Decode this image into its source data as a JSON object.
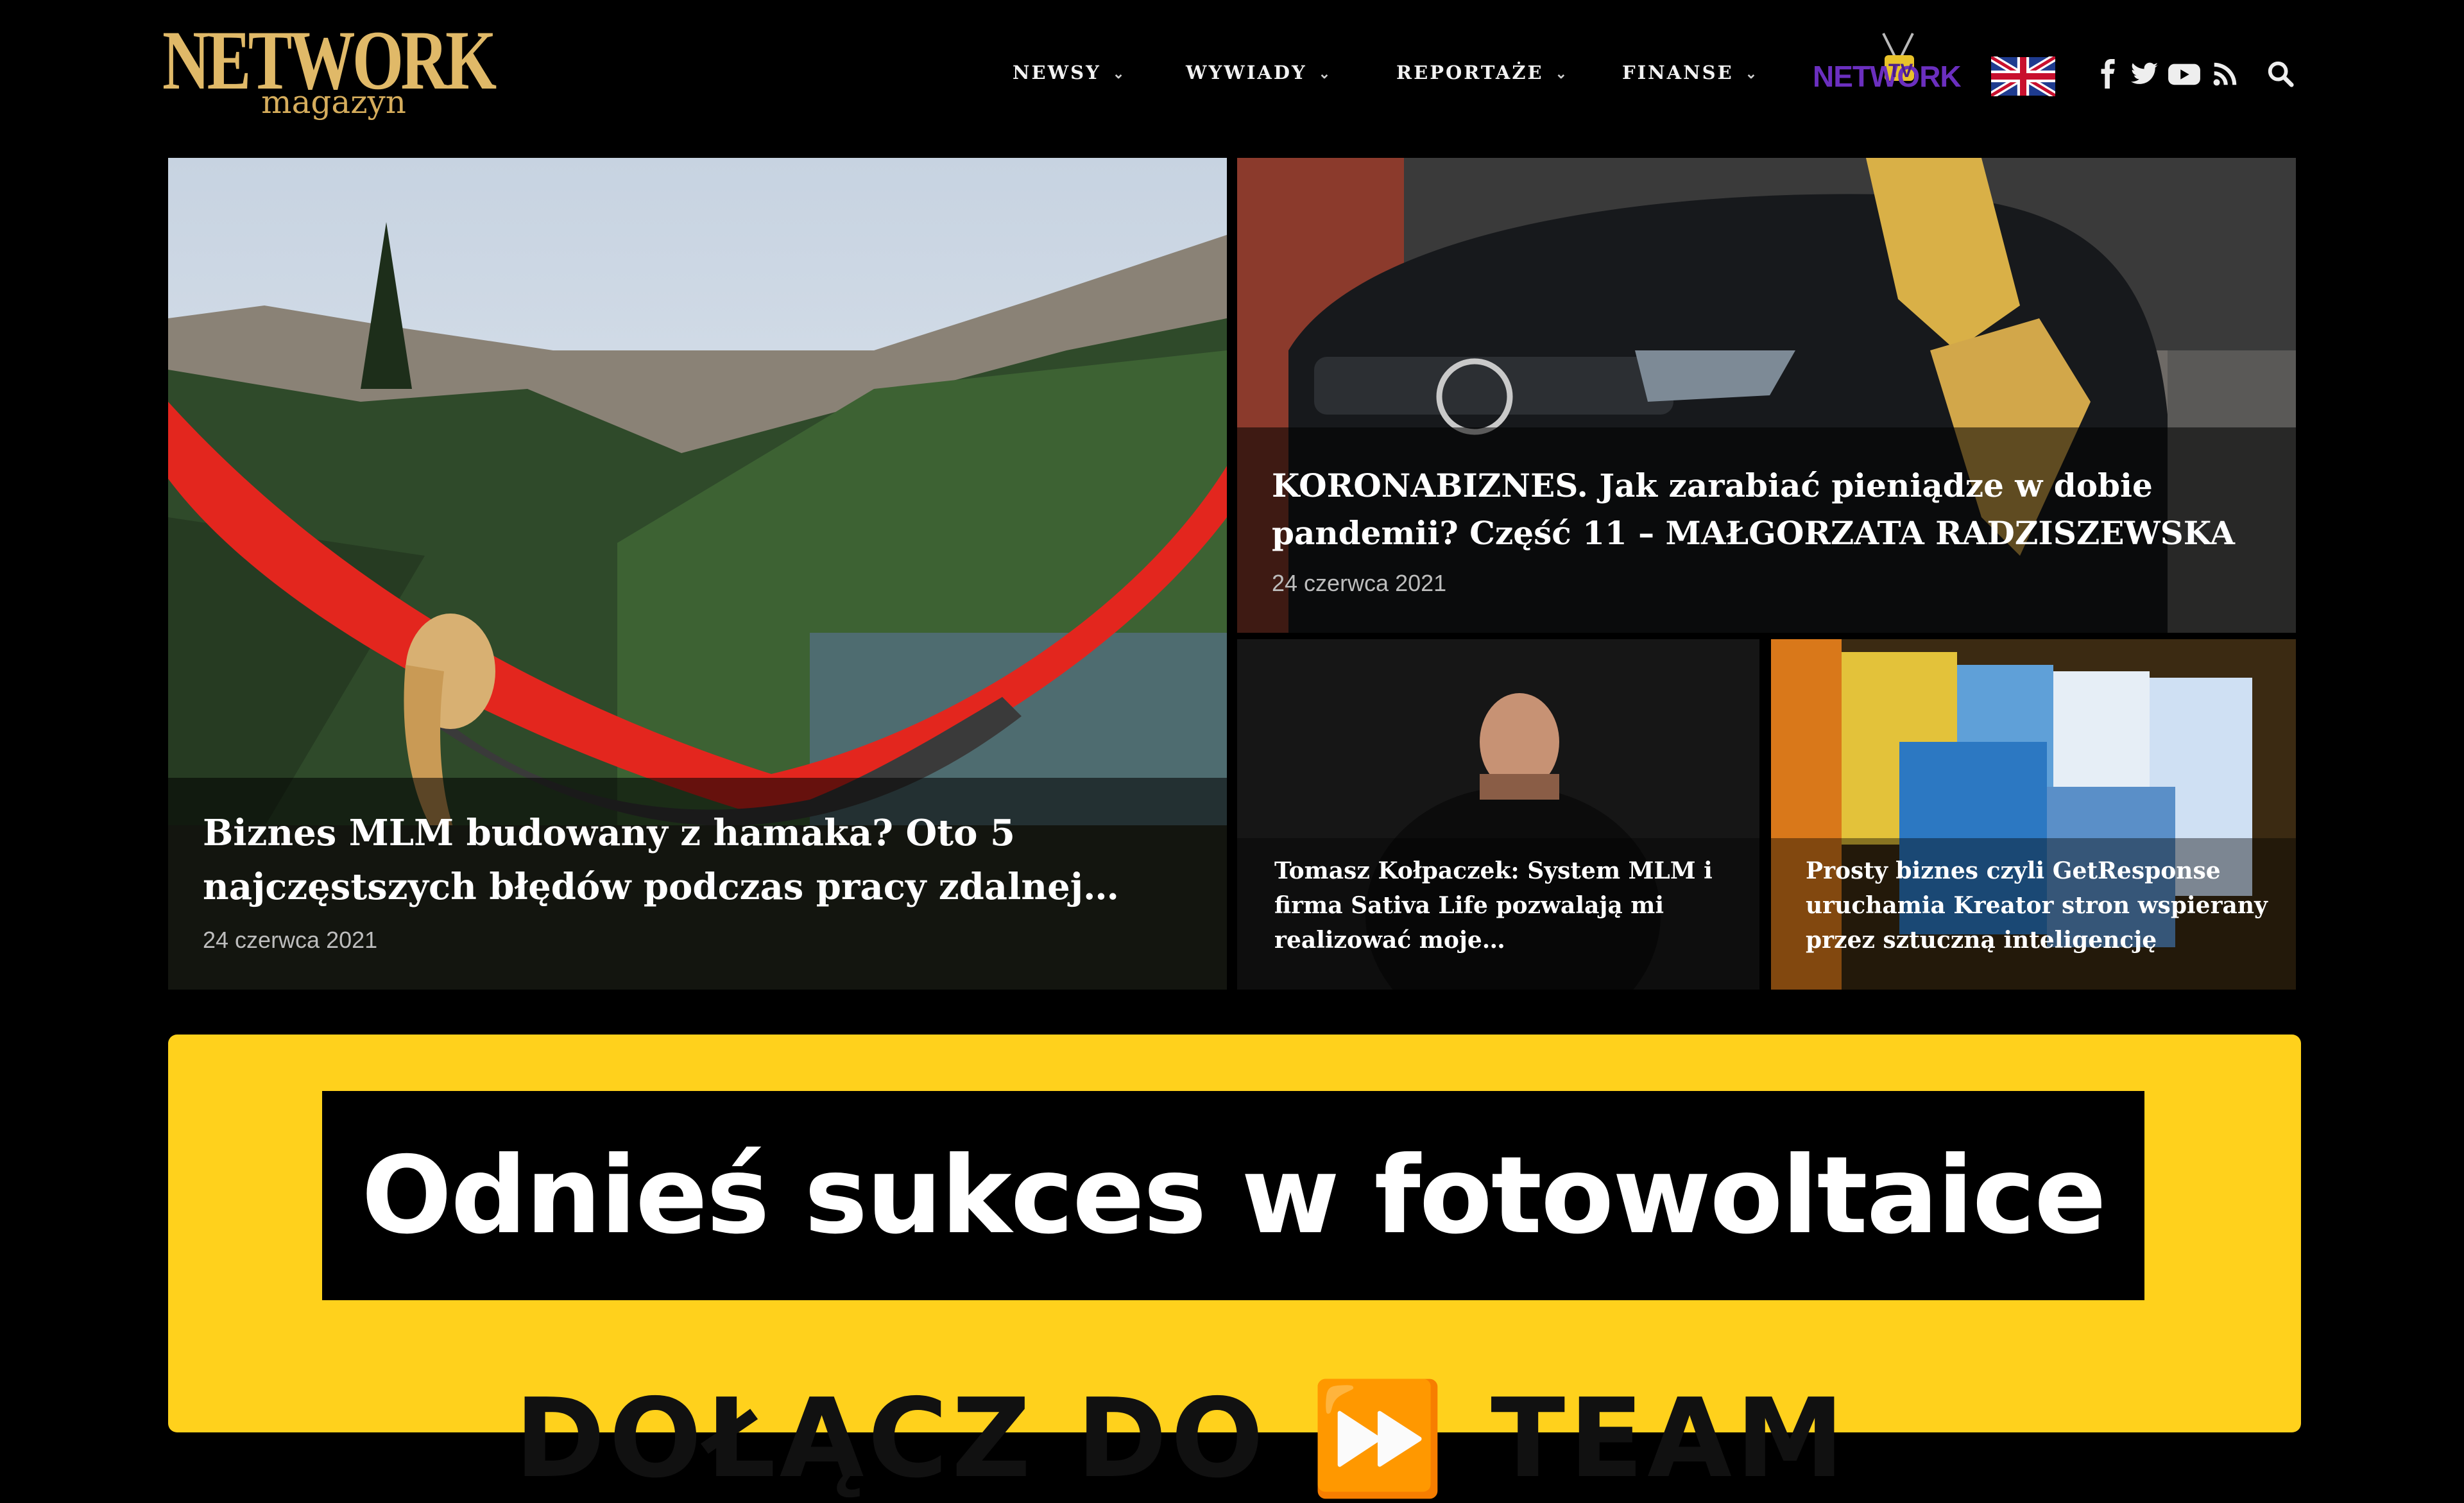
{
  "header": {
    "logo_main": "NETWORK",
    "logo_sub": "magazyn",
    "nav": [
      {
        "label": "NEWSY"
      },
      {
        "label": "WYWIADY"
      },
      {
        "label": "REPORTAŻE"
      },
      {
        "label": "FINANSE"
      }
    ],
    "tv_logo_text": "NETWORK",
    "tv_logo_badge": "TV",
    "icons": [
      "facebook-icon",
      "twitter-icon",
      "youtube-icon",
      "rss-icon",
      "search-icon"
    ]
  },
  "features": {
    "main": {
      "title": "Biznes MLM budowany z hamaka? Oto 5 najczęstszych błędów podczas pracy zdalnej…",
      "date": "24 czerwca 2021"
    },
    "top_right": {
      "title": "KORONABIZNES. Jak zarabiać pieniądze w dobie pandemii? Część 11 – MAŁGORZATA RADZISZEWSKA",
      "date": "24 czerwca 2021"
    },
    "bottom_left": {
      "title": "Tomasz Kołpaczek: System MLM i firma Sativa Life pozwalają mi realizować moje…"
    },
    "bottom_right": {
      "title": "Prosty biznes czyli GetResponse uruchamia Kreator stron wspierany przez sztuczną inteligencję"
    }
  },
  "banner": {
    "headline": "Odnieś sukces w fotowoltaice",
    "sub": "DOŁĄCZ DO ⏩ TEAM"
  },
  "colors": {
    "background": "#000000",
    "logo_gold": "#e0b968",
    "banner_yellow": "#ffd11c",
    "tv_purple": "#6b2fbf"
  }
}
